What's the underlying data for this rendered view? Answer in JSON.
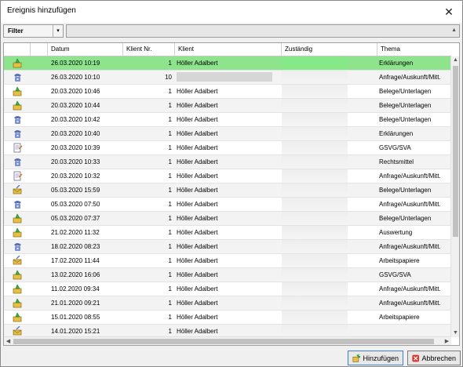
{
  "window": {
    "title": "Ereignis hinzufügen",
    "close_label": "✕"
  },
  "filter": {
    "label": "Filter",
    "value": ""
  },
  "columns": [
    "Datum",
    "Klient Nr.",
    "Klient",
    "Zuständig",
    "Thema"
  ],
  "rows": [
    {
      "icon": "event-icon",
      "date": "26.03.2020 10:19",
      "nr": "1",
      "client": "Höller Adalbert",
      "topic": "Erklärungen"
    },
    {
      "icon": "phone-icon",
      "date": "26.03.2020 10:10",
      "nr": "10",
      "client": "",
      "topic": "Anfrage/Auskunft/Mitt."
    },
    {
      "icon": "event-icon",
      "date": "20.03.2020 10:46",
      "nr": "1",
      "client": "Höller Adalbert",
      "topic": "Belege/Unterlagen"
    },
    {
      "icon": "event-icon",
      "date": "20.03.2020 10:44",
      "nr": "1",
      "client": "Höller Adalbert",
      "topic": "Belege/Unterlagen"
    },
    {
      "icon": "phone-icon",
      "date": "20.03.2020 10:42",
      "nr": "1",
      "client": "Höller Adalbert",
      "topic": "Belege/Unterlagen"
    },
    {
      "icon": "phone-icon",
      "date": "20.03.2020 10:40",
      "nr": "1",
      "client": "Höller Adalbert",
      "topic": "Erklärungen"
    },
    {
      "icon": "note-icon",
      "date": "20.03.2020 10:39",
      "nr": "1",
      "client": "Höller Adalbert",
      "topic": "GSVG/SVA"
    },
    {
      "icon": "phone-icon",
      "date": "20.03.2020 10:33",
      "nr": "1",
      "client": "Höller Adalbert",
      "topic": "Rechtsmittel"
    },
    {
      "icon": "note-icon",
      "date": "20.03.2020 10:32",
      "nr": "1",
      "client": "Höller Adalbert",
      "topic": "Anfrage/Auskunft/Mitt."
    },
    {
      "icon": "mail-icon",
      "date": "05.03.2020 15:59",
      "nr": "1",
      "client": "Höller Adalbert",
      "topic": "Belege/Unterlagen"
    },
    {
      "icon": "phone-icon",
      "date": "05.03.2020 07:50",
      "nr": "1",
      "client": "Höller Adalbert",
      "topic": "Anfrage/Auskunft/Mitt."
    },
    {
      "icon": "event-icon",
      "date": "05.03.2020 07:37",
      "nr": "1",
      "client": "Höller Adalbert",
      "topic": "Belege/Unterlagen"
    },
    {
      "icon": "event-icon",
      "date": "21.02.2020 11:32",
      "nr": "1",
      "client": "Höller Adalbert",
      "topic": "Auswertung"
    },
    {
      "icon": "phone-icon",
      "date": "18.02.2020 08:23",
      "nr": "1",
      "client": "Höller Adalbert",
      "topic": "Anfrage/Auskunft/Mitt."
    },
    {
      "icon": "mail-icon",
      "date": "17.02.2020 11:44",
      "nr": "1",
      "client": "Höller Adalbert",
      "topic": "Arbeitspapiere"
    },
    {
      "icon": "event-icon",
      "date": "13.02.2020 16:06",
      "nr": "1",
      "client": "Höller Adalbert",
      "topic": "GSVG/SVA"
    },
    {
      "icon": "event-icon",
      "date": "11.02.2020 09:34",
      "nr": "1",
      "client": "Höller Adalbert",
      "topic": "Anfrage/Auskunft/Mitt."
    },
    {
      "icon": "event-icon",
      "date": "21.01.2020 09:21",
      "nr": "1",
      "client": "Höller Adalbert",
      "topic": "Anfrage/Auskunft/Mitt."
    },
    {
      "icon": "event-icon",
      "date": "15.01.2020 08:55",
      "nr": "1",
      "client": "Höller Adalbert",
      "topic": "Arbeitspapiere"
    },
    {
      "icon": "mail-icon",
      "date": "14.01.2020 15:21",
      "nr": "1",
      "client": "Höller Adalbert",
      "topic": ""
    }
  ],
  "selected_row": 0,
  "buttons": {
    "add_label": "Hinzufügen",
    "cancel_label": "Abbrechen"
  },
  "colors": {
    "selection": "#8de48c",
    "accent_blue": "#3c7fd1"
  }
}
